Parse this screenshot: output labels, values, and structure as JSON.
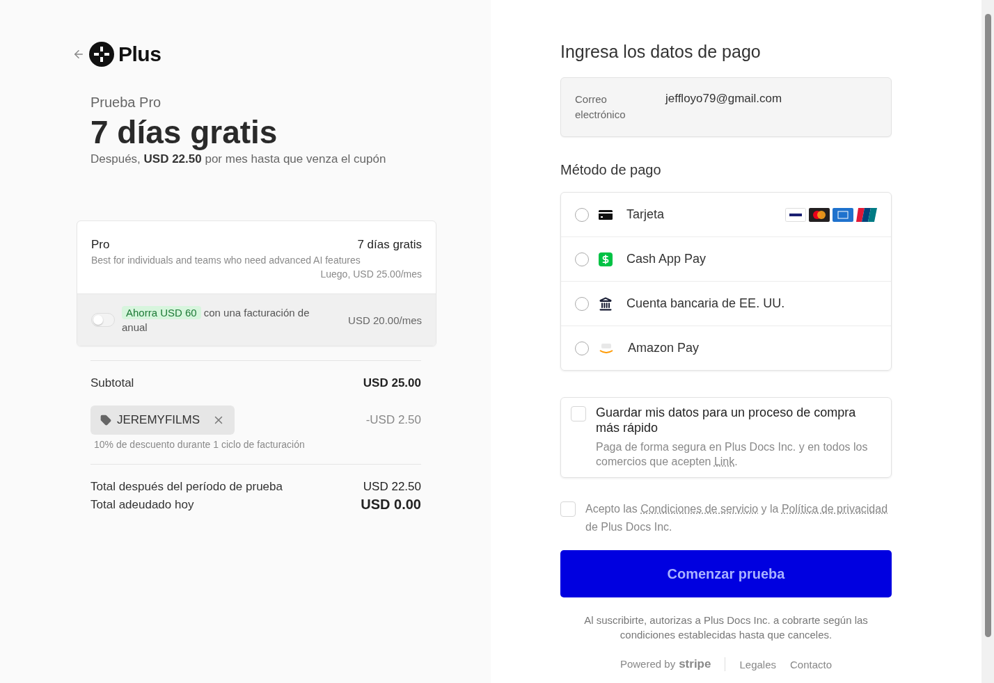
{
  "brand": {
    "name": "Plus"
  },
  "trial": {
    "eyebrow": "Prueba Pro",
    "headline": "7 días gratis",
    "note": "Después, **USD 22.50** por mes hasta que venza el cupón"
  },
  "plan": {
    "name": "Pro",
    "trial": "7 días gratis",
    "description": "Best for individuals and teams who need advanced AI features",
    "then": "Luego, USD 25.00/mes"
  },
  "annual": {
    "on": false,
    "badge": "Ahorra USD 60",
    "text": "con una facturación de anual",
    "price": "USD 20.00/mes"
  },
  "subtotal": {
    "label": "Subtotal",
    "amount": "USD 25.00"
  },
  "coupon": {
    "code": "JEREMYFILMS",
    "amount": "-USD 2.50",
    "note": "10% de descuento durante 1 ciclo de facturación"
  },
  "totals": [
    {
      "label": "Total después del período de prueba",
      "amount": "USD 22.50",
      "strong": false
    },
    {
      "label": "Total adeudado hoy",
      "amount": "USD 0.00",
      "strong": true
    }
  ],
  "title": "Ingresa los datos de pago",
  "email": {
    "label": "Correo electrónico",
    "value": "jeffloyo79@gmail.com"
  },
  "payment": {
    "title": "Método de pago",
    "options": [
      {
        "kind": "card",
        "label": "Tarjeta",
        "selected": false
      },
      {
        "kind": "cashapp",
        "label": "Cash App Pay",
        "selected": false
      },
      {
        "kind": "bank",
        "label": "Cuenta bancaria de EE. UU.",
        "selected": false
      },
      {
        "kind": "amazon",
        "label": "Amazon Pay",
        "selected": false
      }
    ]
  },
  "save_info": {
    "checked": false,
    "title": "Guardar mis datos para un proceso de compra más rápido",
    "text_before": "Paga de forma segura en Plus Docs Inc. y en todos los comercios que acepten ",
    "link": "Link",
    "text_after": "."
  },
  "terms": {
    "checked": false,
    "text_before": "Acepto las ",
    "link_terms": "Condiciones de servicio",
    "text_middle": " y la ",
    "link_privacy": "Política de privacidad",
    "text_after": " de Plus Docs Inc."
  },
  "submit": {
    "label": "Comenzar prueba",
    "disabled": true
  },
  "disclaimer": "Al suscribirte, autorizas a Plus Docs Inc. a cobrarte según las condiciones establecidas hasta que canceles.",
  "footer": {
    "powered": "Powered by",
    "brand": "stripe",
    "links": [
      "Legales",
      "Contacto"
    ]
  }
}
